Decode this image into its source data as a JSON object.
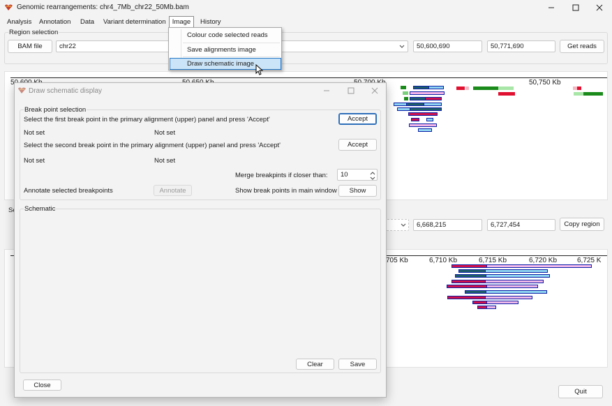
{
  "app": {
    "title": "Genomic rearrangements: chr4_7Mb_chr22_50Mb.bam"
  },
  "window_controls": [
    "minimize-icon",
    "maximize-icon",
    "close-icon"
  ],
  "menu": {
    "analysis": "Analysis",
    "annotation": "Annotation",
    "data": "Data",
    "variant": "Variant determination",
    "image": "Image",
    "history": "History"
  },
  "image_menu": {
    "items": [
      "Colour code selected reads",
      "Save alignments image",
      "Draw schematic image"
    ]
  },
  "region": {
    "group_label": "Region selection",
    "bam_button": "BAM file",
    "chrom": "chr22",
    "start": "50,600,690",
    "end": "50,771,690",
    "get_reads": "Get reads"
  },
  "upper_axis": {
    "ticks": [
      "50,600 Kb",
      "50,650 Kb",
      "50,700 Kb",
      "50,750 Kb"
    ]
  },
  "second_region": {
    "label": "Se",
    "start": "6,668,215",
    "end": "6,727,454",
    "copy_region": "Copy region"
  },
  "lower_axis": {
    "ticks": [
      "705 Kb",
      "6,710 Kb",
      "6,715 Kb",
      "6,720 Kb",
      "6,725 K"
    ]
  },
  "quit": "Quit",
  "dialog": {
    "title": "Draw schematic display",
    "breakpoint_group": "Break point selection",
    "instruction_first": "Select the first break point in the primary alignment (upper) panel and press 'Accept'",
    "accept1": "Accept",
    "first_a": "Not set",
    "first_b": "Not set",
    "instruction_second": "Select the second break point in the primary alignment (upper) panel and press 'Accept'",
    "accept2": "Accept",
    "second_a": "Not set",
    "second_b": "Not set",
    "merge_label": "Merge breakpints if closer than:",
    "merge_value": "10",
    "annotate_label": "Annotate selected breakpoints",
    "annotate_button": "Annotate",
    "show_label": "Show break points in main window",
    "show_button": "Show",
    "schematic_group": "Schematic",
    "clear": "Clear",
    "save": "Save",
    "close": "Close"
  }
}
